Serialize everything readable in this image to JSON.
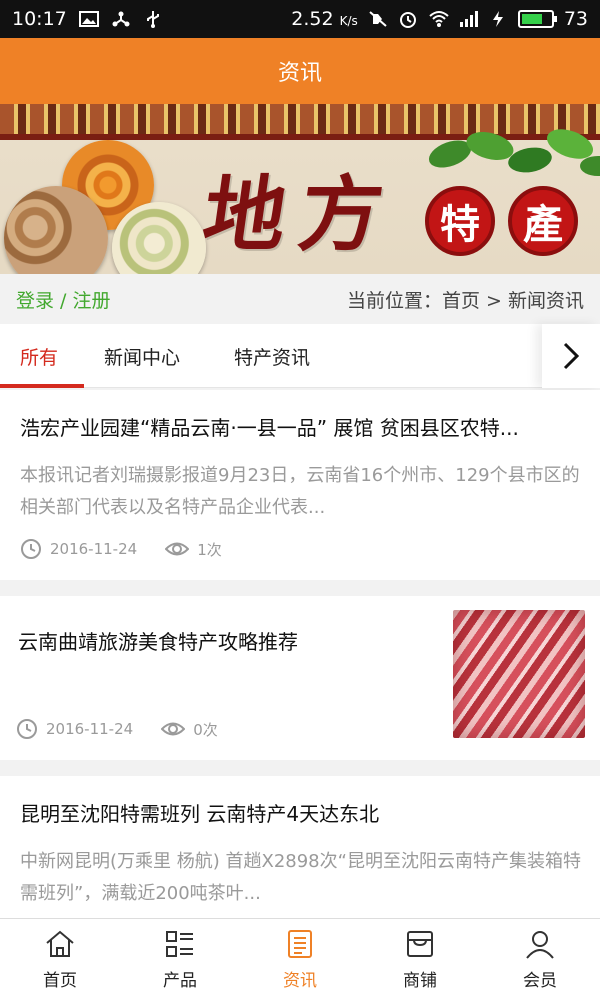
{
  "status_bar": {
    "time": "10:17",
    "speed": "2.52",
    "speed_unit": "K/s",
    "battery": "73",
    "battery_fill": 0.73,
    "battery_color": "#35d04a"
  },
  "header": {
    "title": "资讯",
    "color": "#ef8126"
  },
  "banner": {
    "calligraphy": "地方",
    "seal_1": "特",
    "seal_2": "產"
  },
  "location_bar": {
    "login_label": "登录",
    "separator": " / ",
    "register_label": "注册",
    "location": "当前位置：首页 > 新闻资讯"
  },
  "tabs": [
    {
      "label": "所有",
      "active": true
    },
    {
      "label": "新闻中心",
      "active": false
    },
    {
      "label": "特产资讯",
      "active": false
    }
  ],
  "articles": [
    {
      "title": "浩宏产业园建“精品云南·一县一品” 展馆 贫困县区农特...",
      "summary": "本报讯记者刘瑞摄影报道9月23日，云南省16个州市、129个县市区的相关部门代表以及名特产品企业代表...",
      "date": "2016-11-24",
      "views": "1次"
    },
    {
      "title": "云南曲靖旅游美食特产攻略推荐",
      "date": "2016-11-24",
      "views": "0次"
    },
    {
      "title": "昆明至沈阳特需班列 云南特产4天达东北",
      "summary": "中新网昆明(万乘里 杨航) 首趟X2898次“昆明至沈阳云南特产集装箱特需班列”，满载近200吨茶叶..."
    }
  ],
  "bottom_nav": [
    {
      "label": "首页",
      "icon": "home-icon"
    },
    {
      "label": "产品",
      "icon": "list-icon"
    },
    {
      "label": "资讯",
      "icon": "news-icon",
      "active": true
    },
    {
      "label": "商铺",
      "icon": "store-icon"
    },
    {
      "label": "会员",
      "icon": "user-icon"
    }
  ],
  "colors": {
    "accent": "#ef8126",
    "tab_active": "#d42a1e",
    "login": "#42a82e"
  }
}
